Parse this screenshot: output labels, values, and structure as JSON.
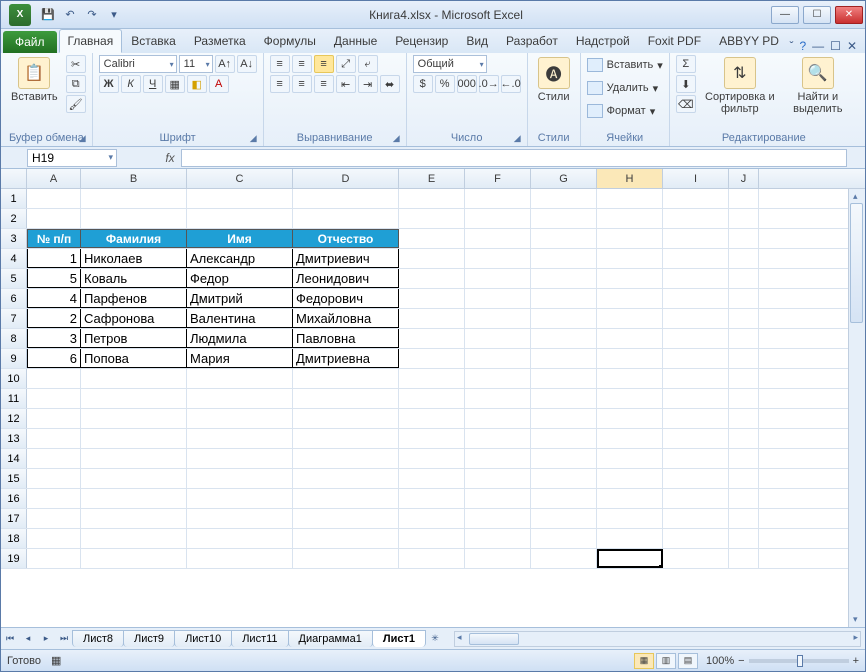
{
  "title": "Книга4.xlsx  -  Microsoft Excel",
  "qat": {
    "save": "💾",
    "undo": "↶",
    "redo": "↷"
  },
  "tabs": {
    "file": "Файл",
    "items": [
      "Главная",
      "Вставка",
      "Разметка",
      "Формулы",
      "Данные",
      "Рецензир",
      "Вид",
      "Разработ",
      "Надстрой",
      "Foxit PDF",
      "ABBYY PD"
    ],
    "active": 0
  },
  "ribbon": {
    "clipboard": {
      "label": "Буфер обмена",
      "paste": "Вставить"
    },
    "font": {
      "label": "Шрифт",
      "name": "Calibri",
      "size": "11"
    },
    "align": {
      "label": "Выравнивание"
    },
    "number": {
      "label": "Число",
      "format": "Общий"
    },
    "styles": {
      "label": "Стили",
      "btn": "Стили"
    },
    "cells": {
      "label": "Ячейки",
      "insert": "Вставить",
      "delete": "Удалить",
      "format": "Формат"
    },
    "editing": {
      "label": "Редактирование",
      "sort": "Сортировка и фильтр",
      "find": "Найти и выделить"
    }
  },
  "namebox": "H19",
  "fx": "fx",
  "columns": [
    "A",
    "B",
    "C",
    "D",
    "E",
    "F",
    "G",
    "H",
    "I",
    "J"
  ],
  "selected_col": "H",
  "row_labels": [
    1,
    2,
    3,
    4,
    5,
    6,
    7,
    8,
    9,
    10,
    11,
    12,
    13,
    14,
    15,
    16,
    17,
    18,
    19
  ],
  "headers": [
    "№ п/п",
    "Фамилия",
    "Имя",
    "Отчество"
  ],
  "data_rows": [
    {
      "n": "1",
      "f": "Николаев",
      "i": "Александр",
      "o": "Дмитриевич"
    },
    {
      "n": "5",
      "f": "Коваль",
      "i": "Федор",
      "o": "Леонидович"
    },
    {
      "n": "4",
      "f": "Парфенов",
      "i": "Дмитрий",
      "o": "Федорович"
    },
    {
      "n": "2",
      "f": "Сафронова",
      "i": "Валентина",
      "o": "Михайловна"
    },
    {
      "n": "3",
      "f": "Петров",
      "i": "Людмила",
      "o": "Павловна"
    },
    {
      "n": "6",
      "f": "Попова",
      "i": "Мария",
      "o": "Дмитриевна"
    }
  ],
  "sheets": [
    "Лист8",
    "Лист9",
    "Лист10",
    "Лист11",
    "Диаграмма1",
    "Лист1"
  ],
  "active_sheet": 5,
  "status": {
    "ready": "Готово",
    "zoom": "100%"
  }
}
